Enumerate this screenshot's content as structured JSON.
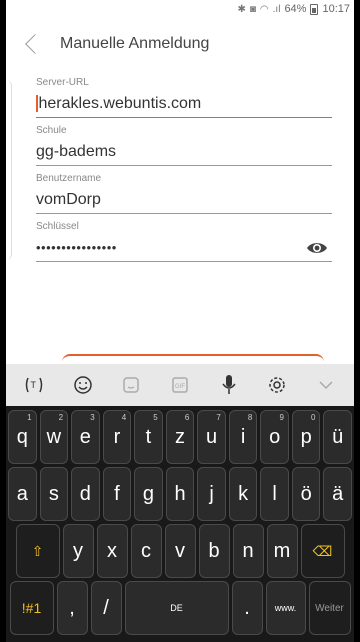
{
  "status_bar": {
    "bt_icon": "bluetooth-icon",
    "wifi_icon": "wifi-icon",
    "signal_icon": "signal-icon",
    "battery_text": "64%",
    "time": "10:17"
  },
  "header": {
    "back_icon": "chevron-left-icon",
    "title": "Manuelle Anmeldung"
  },
  "form": {
    "server_url": {
      "label": "Server-URL",
      "value": "herakles.webuntis.com"
    },
    "school": {
      "label": "Schule",
      "value": "gg-badems"
    },
    "username": {
      "label": "Benutzername",
      "value": "vomDorp"
    },
    "password": {
      "label": "Schlüssel",
      "value": "••••••••••••••••",
      "eye_icon": "eye-icon"
    }
  },
  "keyboard_toolbar": {
    "items": [
      "translate-icon",
      "emoji-icon",
      "sticker-icon",
      "gif-icon",
      "mic-icon",
      "settings-icon",
      "chevron-down-icon"
    ]
  },
  "keyboard": {
    "row1": [
      {
        "k": "q",
        "n": "1"
      },
      {
        "k": "w",
        "n": "2"
      },
      {
        "k": "e",
        "n": "3"
      },
      {
        "k": "r",
        "n": "4"
      },
      {
        "k": "t",
        "n": "5"
      },
      {
        "k": "z",
        "n": "6"
      },
      {
        "k": "u",
        "n": "7"
      },
      {
        "k": "i",
        "n": "8"
      },
      {
        "k": "o",
        "n": "9"
      },
      {
        "k": "p",
        "n": "0"
      },
      {
        "k": "ü",
        "n": ""
      }
    ],
    "row2": [
      "a",
      "s",
      "d",
      "f",
      "g",
      "h",
      "j",
      "k",
      "l",
      "ö",
      "ä"
    ],
    "row3": [
      "y",
      "x",
      "c",
      "v",
      "b",
      "n",
      "m"
    ],
    "shift": "⇧",
    "backspace": "⌫",
    "symbols": "!#1",
    "comma": ",",
    "slash": "/",
    "space": "DE",
    "dot": ".",
    "www": "www.",
    "go": "Weiter"
  },
  "colors": {
    "accent": "#e2602b",
    "keyboard_bg": "#191919",
    "key_yellow": "#f0c020"
  }
}
